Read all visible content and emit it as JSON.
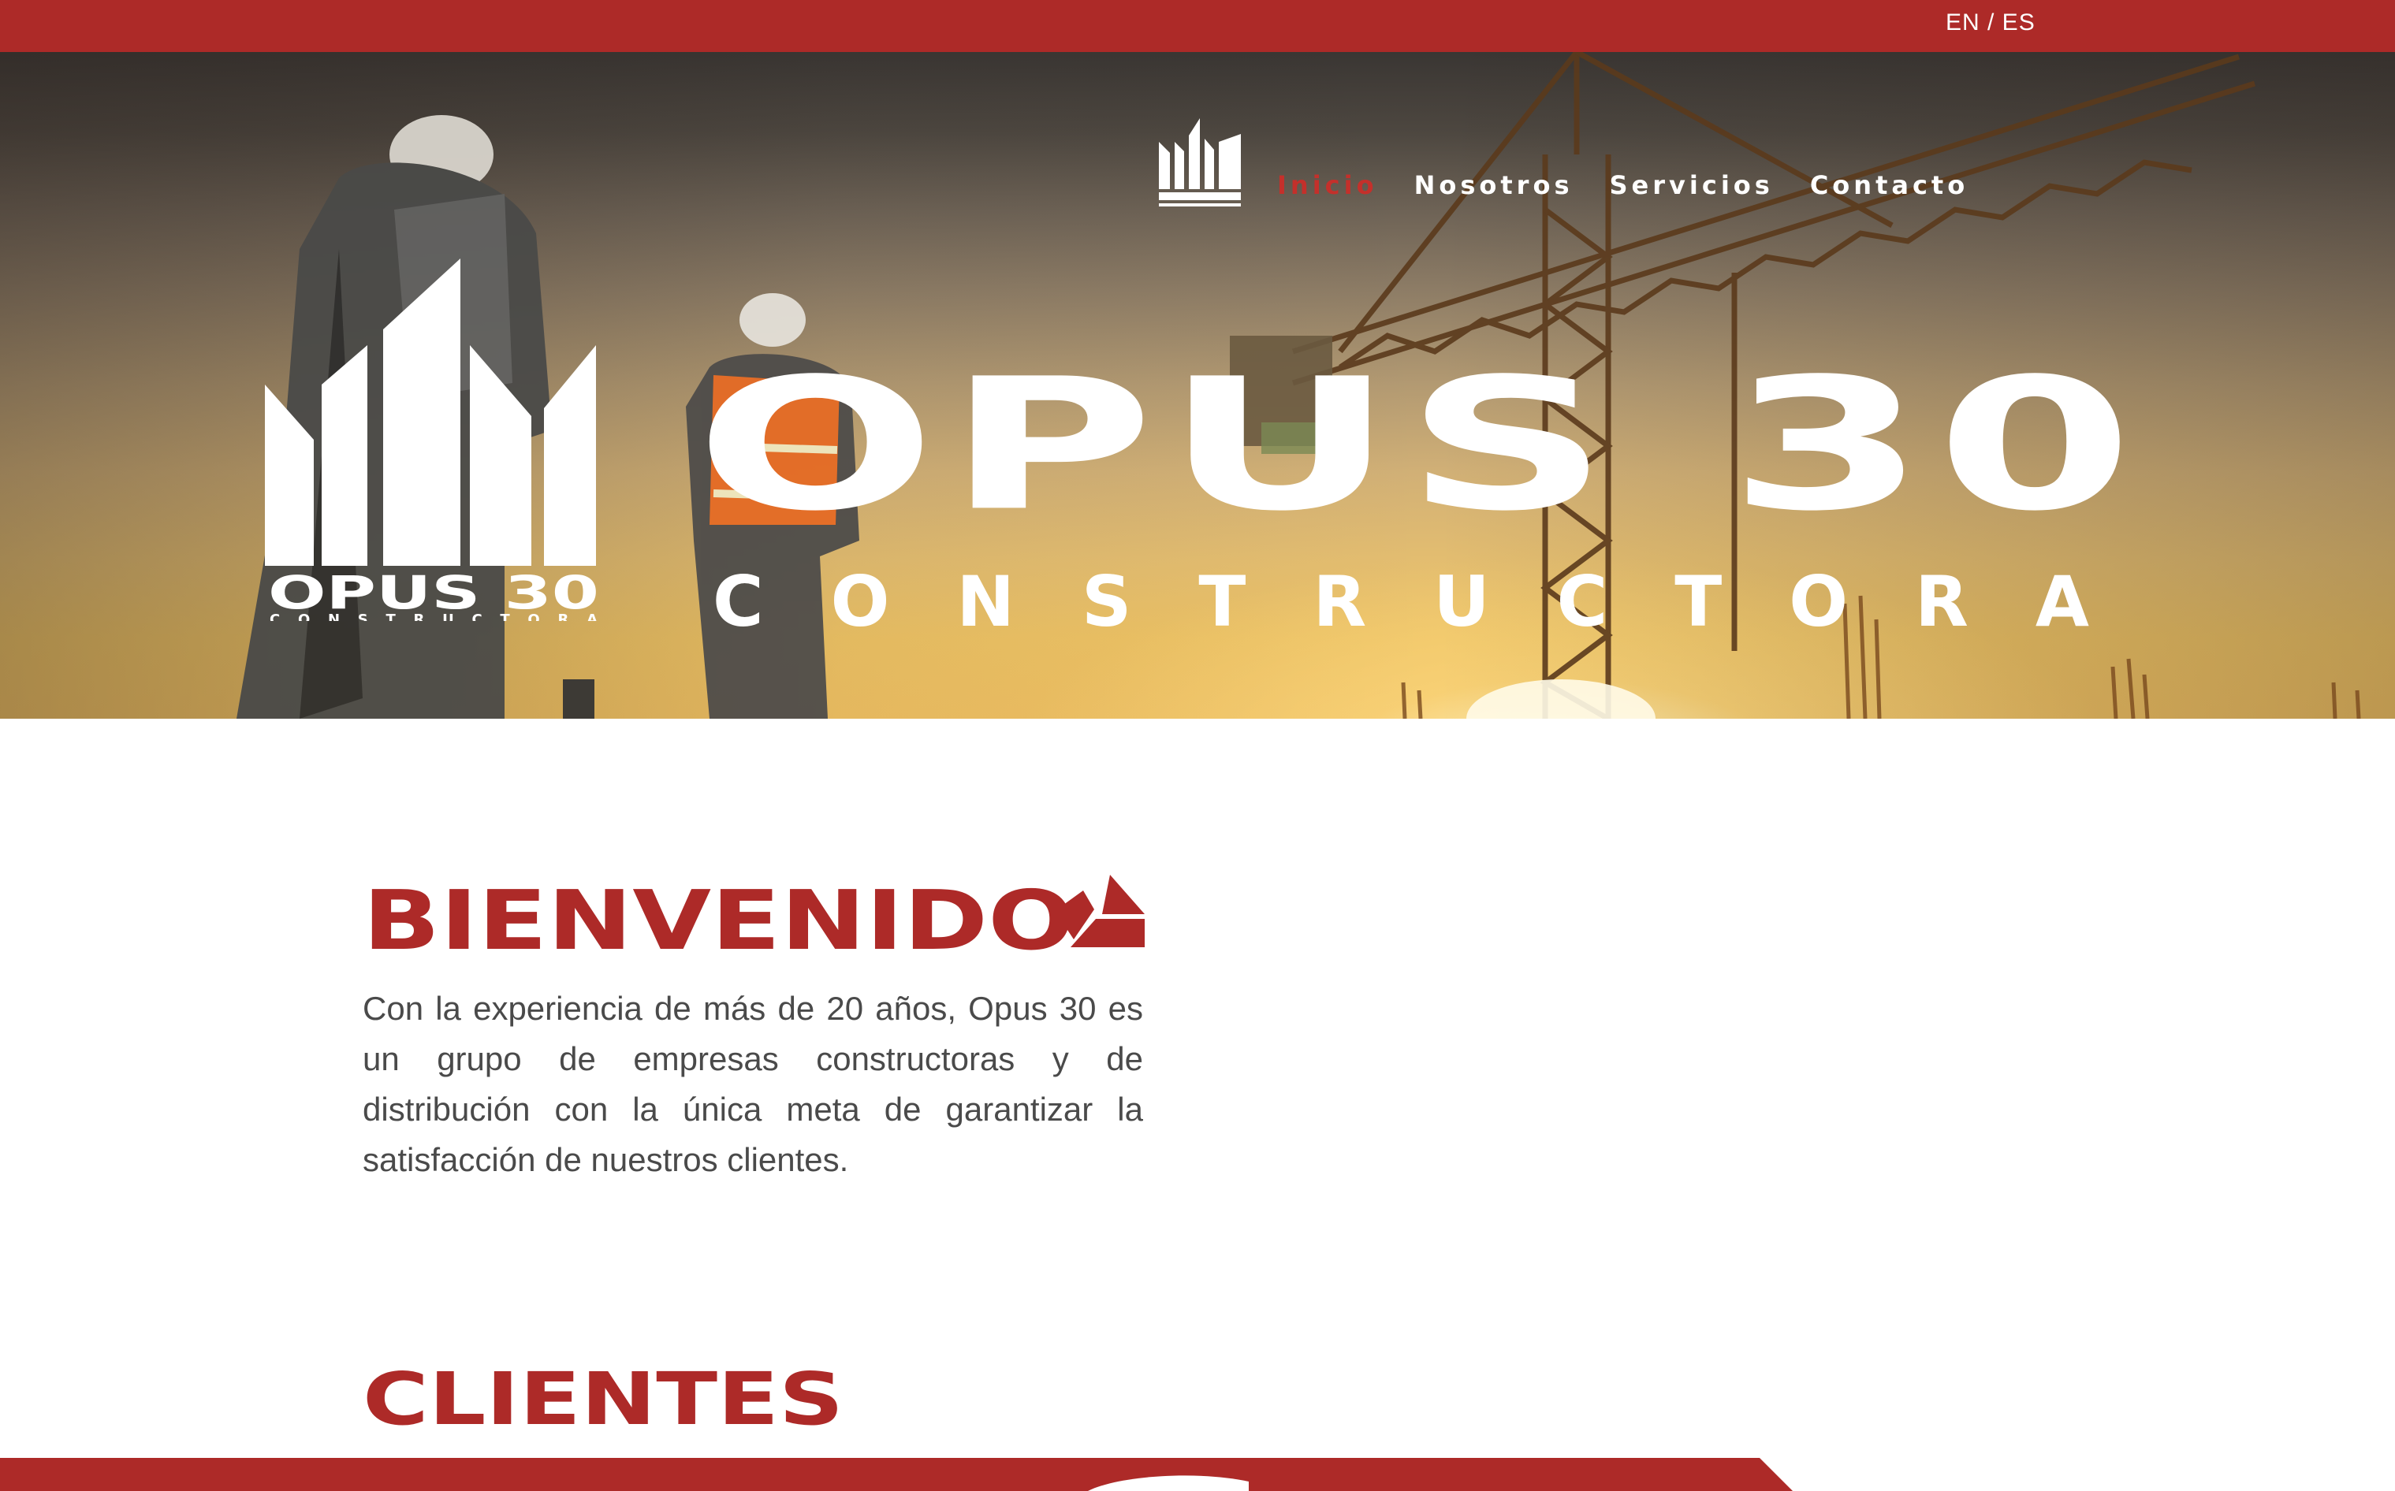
{
  "lang_switch": "EN / ES",
  "nav": {
    "items": [
      {
        "label": "Inicio",
        "active": true
      },
      {
        "label": "Nosotros",
        "active": false
      },
      {
        "label": "Servicios",
        "active": false
      },
      {
        "label": "Contacto",
        "active": false
      }
    ]
  },
  "logo": {
    "word": "OPUS 30",
    "sub": "CONSTRUCTORA"
  },
  "hero": {
    "title": "OPUS 30",
    "subtitle": "CONSTRUCTORA",
    "slides": 5,
    "current_slide": 1
  },
  "welcome": {
    "title": "BIENVENIDO",
    "text": "Con la experiencia de más de 20 años, Opus 30 es un grupo de empresas constructoras y de distribución con la única meta de garantizar la satisfacción de nuestros clientes."
  },
  "clients": {
    "title": "CLIENTES"
  },
  "colors": {
    "brand_red": "#ad2a28",
    "active_nav": "#c4302b",
    "text": "#4a4a4a"
  },
  "icons": [
    "opus30-logo-icon",
    "opus30-mark-icon"
  ]
}
